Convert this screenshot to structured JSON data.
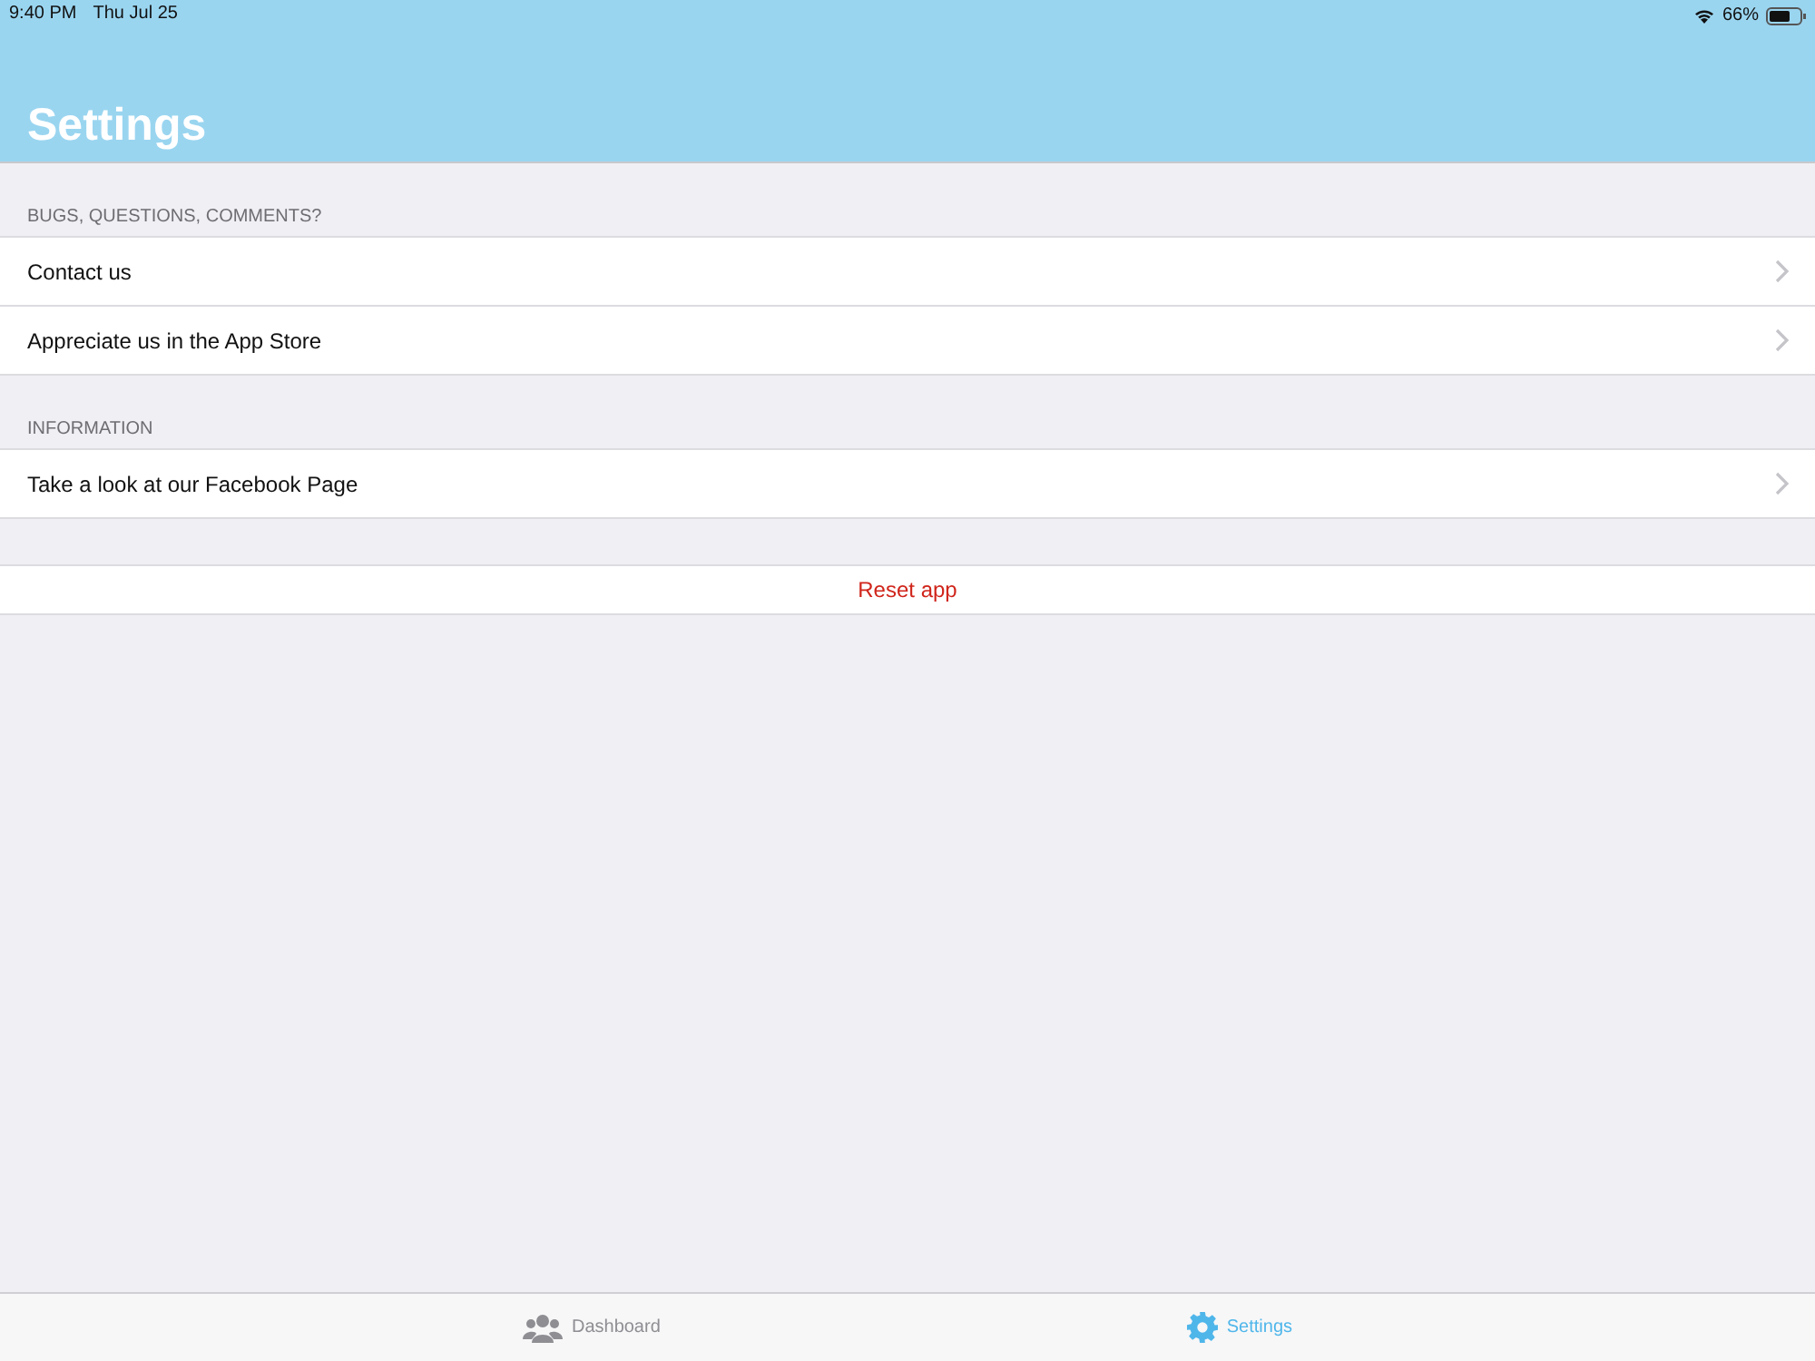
{
  "status_bar": {
    "time": "9:40 PM",
    "date": "Thu Jul 25",
    "battery": "66%"
  },
  "header": {
    "title": "Settings"
  },
  "sections": [
    {
      "header": "BUGS, QUESTIONS, COMMENTS?",
      "rows": [
        {
          "kind": "link",
          "label": "Contact us"
        },
        {
          "kind": "link",
          "label": "Appreciate us in the App Store"
        }
      ]
    },
    {
      "header": "INFORMATION",
      "rows": [
        {
          "kind": "link",
          "label": "Take a look at our Facebook Page"
        }
      ]
    },
    {
      "rows": [
        {
          "kind": "destructive",
          "label": "Reset app"
        }
      ]
    }
  ],
  "tabs": [
    {
      "label": "Dashboard",
      "kind": "people",
      "selected": false
    },
    {
      "label": "Settings",
      "kind": "gear",
      "selected": true
    }
  ]
}
